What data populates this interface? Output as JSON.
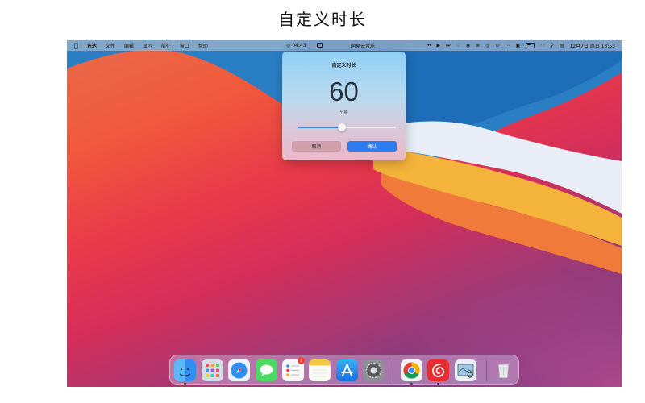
{
  "page_title": "自定义时长",
  "menubar": {
    "items": [
      "访达",
      "文件",
      "编辑",
      "显示",
      "前往",
      "窗口",
      "帮助"
    ],
    "timer": "04:43",
    "app_name": "网易云音乐",
    "datetime": "12月7日 周日 13:53"
  },
  "dialog": {
    "title": "自定义时长",
    "value": "60",
    "unit": "分钟",
    "slider_fraction": 0.45,
    "cancel_label": "取消",
    "confirm_label": "确认"
  },
  "dock": {
    "apps": [
      {
        "name": "finder-icon",
        "running": true
      },
      {
        "name": "launchpad-icon",
        "running": false
      },
      {
        "name": "safari-icon",
        "running": false
      },
      {
        "name": "messages-icon",
        "running": false
      },
      {
        "name": "reminders-icon",
        "running": false,
        "badge": "1"
      },
      {
        "name": "notes-icon",
        "running": false
      },
      {
        "name": "app-store-icon",
        "running": false
      },
      {
        "name": "system-preferences-icon",
        "running": false
      },
      {
        "name": "chrome-icon",
        "running": true
      },
      {
        "name": "netease-music-icon",
        "running": true
      },
      {
        "name": "preview-icon",
        "running": false
      },
      {
        "name": "trash-icon",
        "running": false
      }
    ]
  },
  "colors": {
    "accent": "#2f7cf0",
    "slider_fill": "#3a7ee8",
    "badge": "#ff3b30"
  }
}
